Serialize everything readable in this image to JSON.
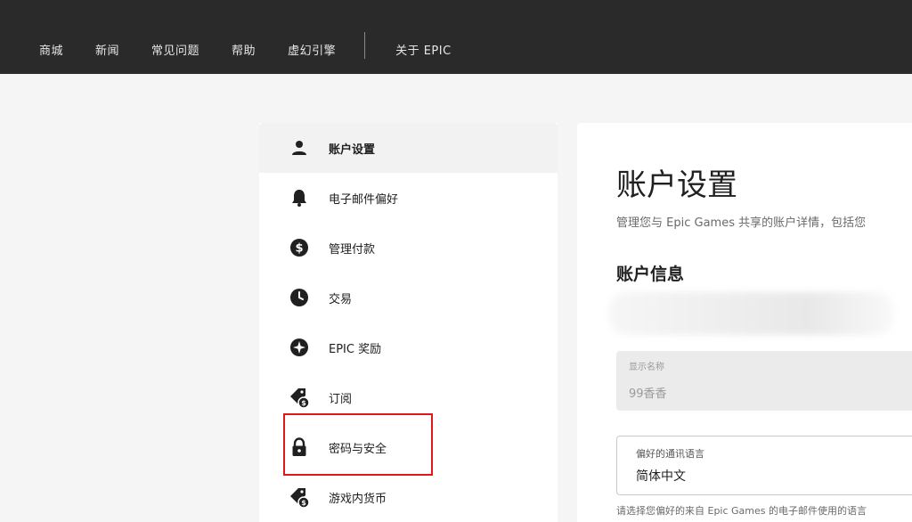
{
  "topnav": {
    "items": [
      "商城",
      "新闻",
      "常见问题",
      "帮助",
      "虚幻引擎"
    ],
    "about": "关于 EPIC"
  },
  "sidebar": {
    "items": [
      {
        "label": "账户设置",
        "icon": "person-icon",
        "active": true
      },
      {
        "label": "电子邮件偏好",
        "icon": "bell-icon"
      },
      {
        "label": "管理付款",
        "icon": "dollar-circle-icon"
      },
      {
        "label": "交易",
        "icon": "clock-icon"
      },
      {
        "label": "EPIC 奖励",
        "icon": "star-badge-icon"
      },
      {
        "label": "订阅",
        "icon": "tag-dollar-icon"
      },
      {
        "label": "密码与安全",
        "icon": "lock-icon",
        "highlighted": true
      },
      {
        "label": "游戏内货币",
        "icon": "tag-coin-icon"
      }
    ]
  },
  "main": {
    "title": "账户设置",
    "description": "管理您与 Epic Games 共享的账户详情，包括您",
    "section_title": "账户信息",
    "display_name": {
      "label": "显示名称",
      "value": "99香香"
    },
    "language": {
      "label": "偏好的通讯语言",
      "value": "简体中文"
    },
    "language_help": "请选择您偏好的来自 Epic Games 的电子邮件使用的语言"
  },
  "colors": {
    "topbar": "#2a2a2a",
    "highlight": "#e0181b",
    "page_bg": "#f5f5f5"
  }
}
